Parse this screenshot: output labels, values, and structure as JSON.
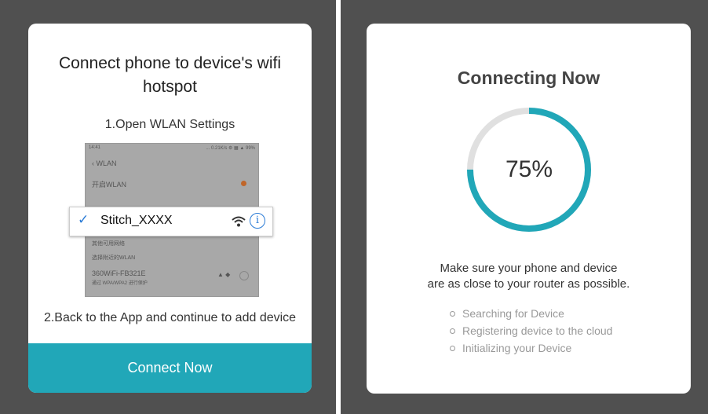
{
  "left_screen": {
    "title": "Connect phone to device's wifi hotspot",
    "step1": "1.Open WLAN Settings",
    "phone_screenshot": {
      "status_time": "14:41",
      "status_right": "... 0.21K/s ⚙ ▦ ▲ 99%",
      "header": "WLAN",
      "wlan_toggle": "开启WLAN",
      "section_label": "其他可用网络",
      "section_label2": "选择附近的WLAN",
      "network_name": "360WiFi-FB321E",
      "network_sub": "通过 WPA/WPA2 进行保护",
      "toggle_color": "#c0662a"
    },
    "wifi_row": {
      "check_icon": "checkmark-icon",
      "network": "Stitch_XXXX",
      "wifi_icon": "wifi-icon",
      "info_icon": "info-icon",
      "info_glyph": "i",
      "check_glyph": "✓"
    },
    "step2": "2.Back to the App and continue to add device",
    "connect_button": "Connect Now",
    "accent_color": "#21a7b8"
  },
  "right_screen": {
    "title": "Connecting Now",
    "progress_percent": 75,
    "progress_label": "75%",
    "hint_line1": "Make sure your phone and device",
    "hint_line2": "are as close to your router as possible.",
    "steps": [
      "Searching for Device",
      "Registering device to the cloud",
      "Initializing your Device"
    ],
    "ring_color": "#21a7b8",
    "ring_track_color": "#e0e0e0"
  }
}
